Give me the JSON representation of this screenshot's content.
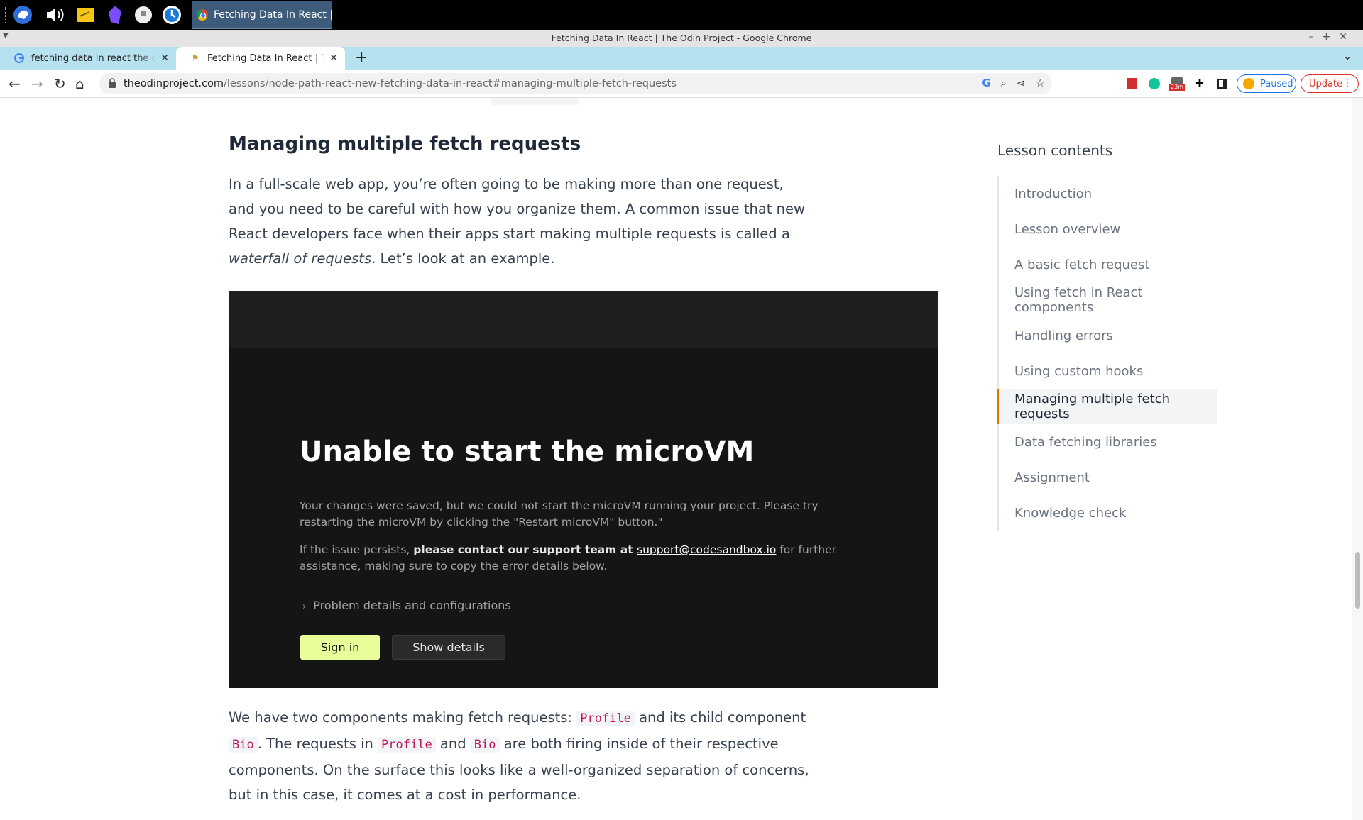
{
  "taskbar": {
    "active_task": "Fetching Data In React | Th..."
  },
  "window": {
    "title": "Fetching Data In React | The Odin Project - Google Chrome"
  },
  "tabs": [
    {
      "label": "fetching data in react the odin project",
      "favicon": "google-icon",
      "active": false
    },
    {
      "label": "Fetching Data In React | The Odin Project",
      "favicon": "odin-icon",
      "active": true
    }
  ],
  "toolbar": {
    "url_host": "theodinproject.com",
    "url_path": "/lessons/node-path-react-new-fetching-data-in-react#managing-multiple-fetch-requests",
    "paused_label": "Paused",
    "update_label": "Update",
    "timer_badge": "23m"
  },
  "article": {
    "heading": "Managing multiple fetch requests",
    "para1_a": "In a full-scale web app, you’re often going to be making more than one request, and you need to be careful with how you organize them. A common issue that new React developers face when their apps start making multiple requests is called a ",
    "para1_em": "waterfall of requests",
    "para1_b": ". Let’s look at an example.",
    "para2_a": "We have two components making fetch requests: ",
    "code_profile": "Profile",
    "para2_b": " and its child component ",
    "code_bio": "Bio",
    "para2_c": ". The requests in ",
    "para2_d": " and ",
    "para2_e": " are both firing inside of their respective components. On the surface this looks like a well-organized separation of concerns, but in this case, it comes at a cost in performance."
  },
  "sandbox": {
    "title": "Unable to start the microVM",
    "msg1": "Your changes were saved, but we could not start the microVM running your project. Please try restarting the microVM by clicking the \"Restart microVM\" button.\"",
    "msg2_a": "If the issue persists, ",
    "msg2_bold": "please contact our support team at ",
    "msg2_link": "support@codesandbox.io",
    "msg2_b": " for further assistance, making sure to copy the error details below.",
    "details_label": "Problem details and configurations",
    "signin_label": "Sign in",
    "show_details_label": "Show details"
  },
  "toc": {
    "heading": "Lesson contents",
    "items": [
      {
        "label": "Introduction"
      },
      {
        "label": "Lesson overview"
      },
      {
        "label": "A basic fetch request"
      },
      {
        "label": "Using fetch in React components"
      },
      {
        "label": "Handling errors"
      },
      {
        "label": "Using custom hooks"
      },
      {
        "label": "Managing multiple fetch requests",
        "active": true
      },
      {
        "label": "Data fetching libraries"
      },
      {
        "label": "Assignment"
      },
      {
        "label": "Knowledge check"
      }
    ]
  },
  "colors": {
    "accent": "#d97706",
    "tab_strip": "#b6e1ef",
    "signin_button": "#e8fc9a"
  }
}
